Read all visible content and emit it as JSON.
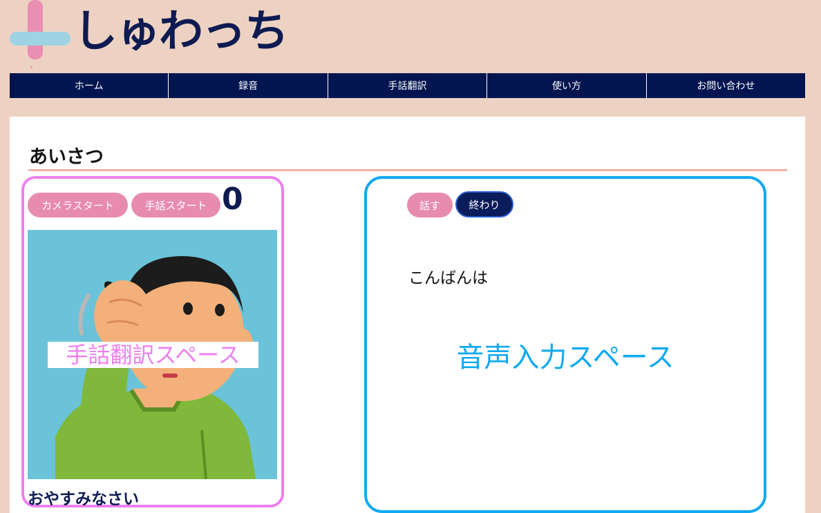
{
  "logo": {
    "text": "しゅわっち"
  },
  "nav": {
    "items": [
      {
        "label": "ホーム"
      },
      {
        "label": "録音"
      },
      {
        "label": "手話翻訳"
      },
      {
        "label": "使い方"
      },
      {
        "label": "お問い合わせ"
      }
    ]
  },
  "main": {
    "title": "あいさつ",
    "sign_panel": {
      "camera_button": "カメラスタート",
      "sign_start_button": "手話スタート",
      "counter": "0",
      "overlay_label": "手話翻訳スペース",
      "result_text": "おやすみなさい"
    },
    "voice_panel": {
      "speak_button": "話す",
      "end_button": "終わり",
      "speech_text": "こんばんは",
      "space_label": "音声入力スペース"
    }
  },
  "colors": {
    "page_bg": "#edd2c3",
    "nav_bg": "#021551",
    "accent_pink": "#e78cae",
    "sign_border": "#ee7fef",
    "voice_border": "#10a9f2"
  }
}
